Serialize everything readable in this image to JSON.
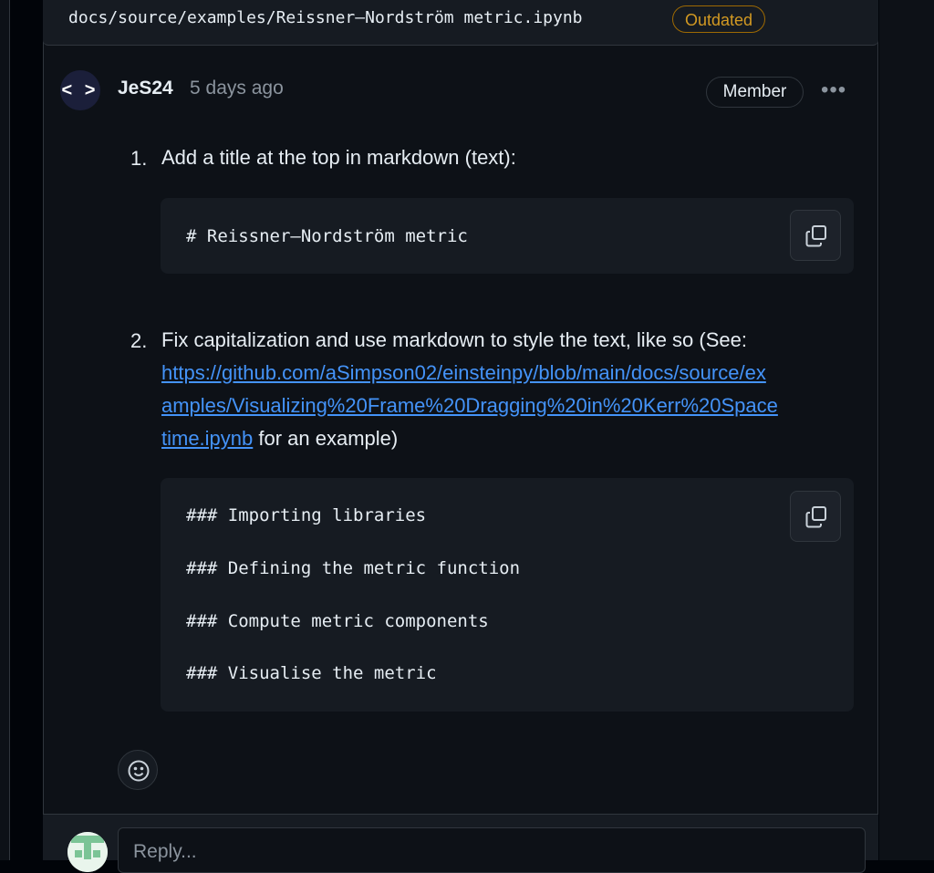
{
  "file": {
    "path": "docs/source/examples/Reissner–Nordström metric.ipynb",
    "badge": "Outdated"
  },
  "comment": {
    "avatar_text": "< >",
    "author": "JeS24",
    "time": "5 days ago",
    "role_badge": "Member",
    "items": [
      {
        "number": "1.",
        "text": "Add a title at the top in markdown (text):",
        "code": [
          "# Reissner–Nordström metric"
        ]
      },
      {
        "number": "2.",
        "text_before": "Fix capitalization and use markdown to style the text, like so (See:",
        "link_lines": [
          "https://github.com/aSimpson02/einsteinpy/blob/main/docs/source/ex",
          "amples/Visualizing%20Frame%20Dragging%20in%20Kerr%20Space",
          "time.ipynb"
        ],
        "text_after": " for an example)",
        "code": [
          "### Importing libraries",
          "### Defining the metric function",
          "### Compute metric components",
          "### Visualise the metric"
        ]
      }
    ]
  },
  "reply": {
    "placeholder": "Reply..."
  },
  "icons": [
    "copy-icon",
    "smiley-icon",
    "kebab-icon"
  ]
}
